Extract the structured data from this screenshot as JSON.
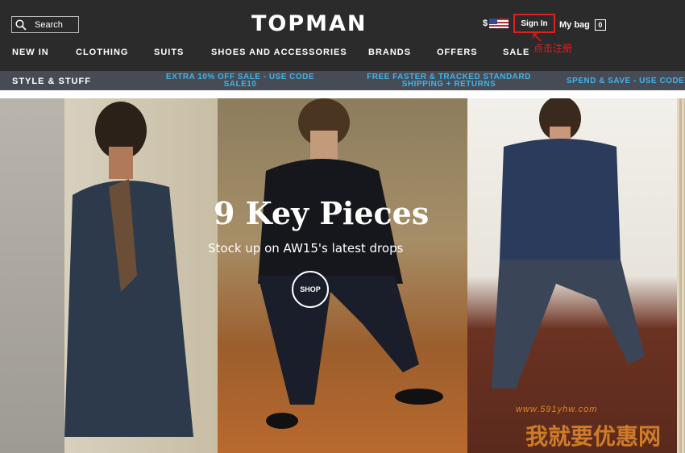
{
  "header": {
    "search_label": "Search",
    "logo": "TOPMAN",
    "currency": "$",
    "signin_label": "Sign In",
    "annotation": "点击注册",
    "bag_label": "My bag",
    "bag_count": "0"
  },
  "nav": [
    "NEW IN",
    "CLOTHING",
    "SUITS",
    "SHOES AND ACCESSORIES",
    "BRANDS",
    "OFFERS",
    "SALE"
  ],
  "promo": {
    "style_label": "STYLE & STUFF",
    "messages": [
      {
        "line1": "EXTRA 10% OFF SALE - USE CODE",
        "line2": "SALE10"
      },
      {
        "line1": "FREE FASTER & TRACKED STANDARD",
        "line2": "SHIPPING + RETURNS"
      },
      {
        "line1": "SPEND & SAVE - USE CODE",
        "line2": ""
      }
    ]
  },
  "hero": {
    "title": "9 Key Pieces",
    "subtitle": "Stock up on AW15's latest drops",
    "cta": "SHOP"
  },
  "watermark": {
    "url": "www.591yhw.com",
    "text": "我就要优惠网"
  }
}
